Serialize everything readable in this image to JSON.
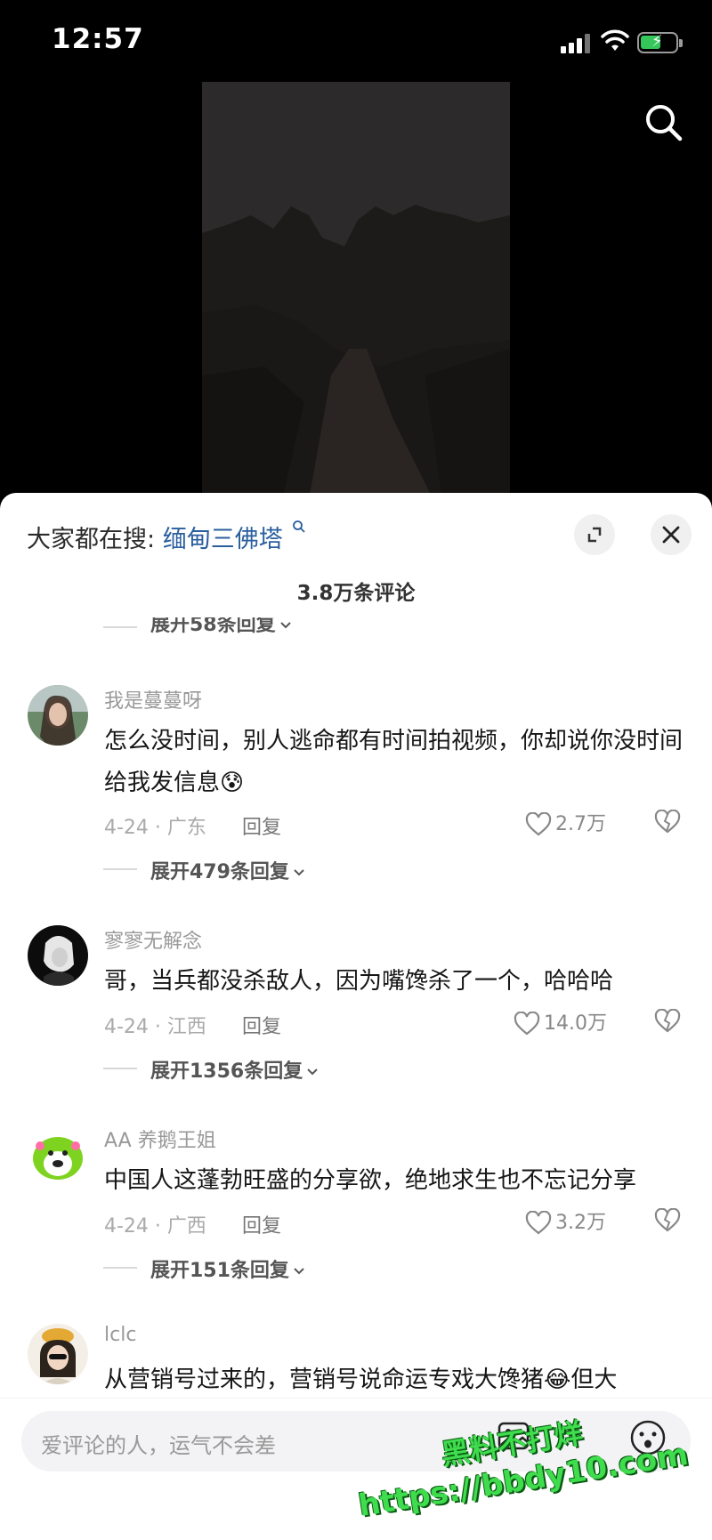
{
  "status_bar": {
    "time": "12:57"
  },
  "trend": {
    "prefix": "大家都在搜:",
    "keyword": "缅甸三佛塔"
  },
  "comment_count": "3.8万条评论",
  "top_expand": "展开58条回复",
  "comments": [
    {
      "username": "我是蔓蔓呀",
      "text": "怎么没时间，别人逃命都有时间拍视频，你却说你没时间给我发信息😰",
      "meta": "4-24 · 广东",
      "reply": "回复",
      "likes": "2.7万",
      "expand": "展开479条回复"
    },
    {
      "username": "寥寥无解念",
      "text": "哥，当兵都没杀敌人，因为嘴馋杀了一个，哈哈哈",
      "meta": "4-24 · 江西",
      "reply": "回复",
      "likes": "14.0万",
      "expand": "展开1356条回复"
    },
    {
      "username": "AA 养鹅王姐",
      "text": "中国人这蓬勃旺盛的分享欲，绝地求生也不忘记分享",
      "meta": "4-24 · 广西",
      "reply": "回复",
      "likes": "3.2万",
      "expand": "展开151条回复"
    },
    {
      "username": "lclc",
      "text": "从营销号过来的，营销号说命运专戏大馋猪😂但大"
    }
  ],
  "input": {
    "placeholder": "爱评论的人，运气不会差"
  },
  "watermark": {
    "line1": "黑料不打烊",
    "line2": "https://bbdy10.com"
  },
  "colors": {
    "keyword": "#2a5f9e",
    "battery": "#35c759",
    "watermark": "#3fdc4e"
  }
}
